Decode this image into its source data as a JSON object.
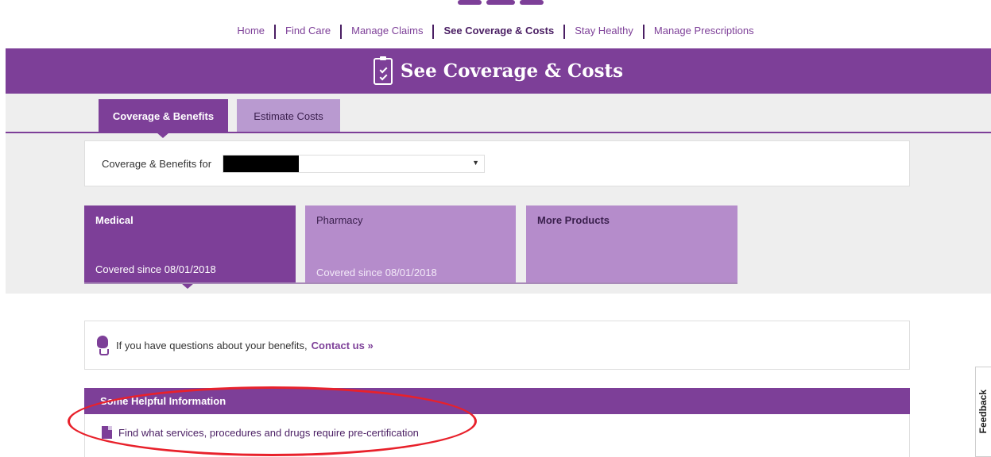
{
  "nav": {
    "items": [
      {
        "label": "Home",
        "active": false
      },
      {
        "label": "Find Care",
        "active": false
      },
      {
        "label": "Manage Claims",
        "active": false
      },
      {
        "label": "See Coverage & Costs",
        "active": true
      },
      {
        "label": "Stay Healthy",
        "active": false
      },
      {
        "label": "Manage Prescriptions",
        "active": false
      }
    ]
  },
  "banner": {
    "title": "See Coverage & Costs",
    "icon": "clipboard-checklist-icon"
  },
  "tabs": [
    {
      "label": "Coverage & Benefits",
      "active": true
    },
    {
      "label": "Estimate Costs",
      "active": false
    }
  ],
  "coverage_select": {
    "label": "Coverage & Benefits for"
  },
  "products": [
    {
      "title": "Medical",
      "since": "Covered since 08/01/2018",
      "selected": true
    },
    {
      "title": "Pharmacy",
      "since": "Covered since 08/01/2018",
      "selected": false
    },
    {
      "title": "More Products",
      "since": "",
      "selected": false
    }
  ],
  "help": {
    "text": "If you have questions about your benefits,",
    "link": "Contact us »"
  },
  "info": {
    "header": "Some Helpful Information",
    "link": "Find what services, procedures and drugs require pre-certification"
  },
  "feedback": {
    "label": "Feedback"
  },
  "colors": {
    "brand": "#7d3f98",
    "brand_light": "#b58ccb",
    "annotation": "#e8212b"
  }
}
